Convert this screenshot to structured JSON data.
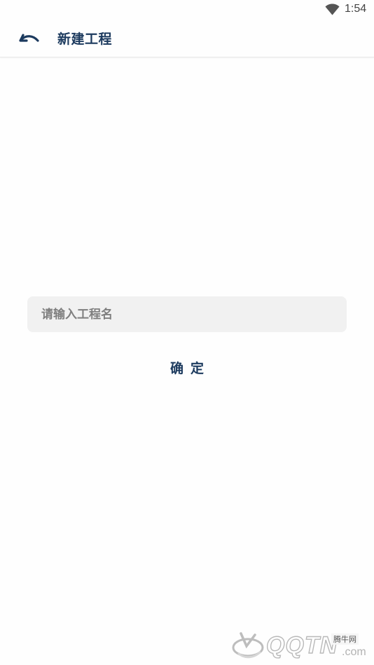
{
  "status_bar": {
    "time": "1:54",
    "wifi_icon": "wifi-icon"
  },
  "app_bar": {
    "back_icon": "undo-arrow-icon",
    "title": "新建工程"
  },
  "form": {
    "name_input": {
      "value": "",
      "placeholder": "请输入工程名"
    },
    "confirm_label": "确定"
  },
  "watermark": {
    "brand": "QQTN",
    "suffix": ".com",
    "badge": "腾牛网"
  },
  "colors": {
    "primary": "#1c3a5e",
    "input_bg": "#f1f1f1",
    "placeholder": "#7f7f7f",
    "background": "#fefefe"
  }
}
